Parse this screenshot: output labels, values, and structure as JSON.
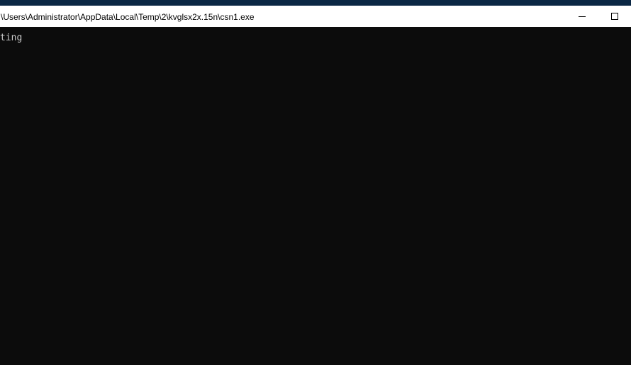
{
  "window": {
    "title": "\\Users\\Administrator\\AppData\\Local\\Temp\\2\\kvglsx2x.15n\\csn1.exe"
  },
  "console": {
    "lines": [
      "ting"
    ]
  },
  "icons": {
    "minimize": "minimize-icon",
    "maximize": "maximize-icon"
  },
  "colors": {
    "titlebar_bg": "#ffffff",
    "console_bg": "#0c0c0c",
    "console_text": "#cccccc",
    "desktop": "#0b2744"
  }
}
